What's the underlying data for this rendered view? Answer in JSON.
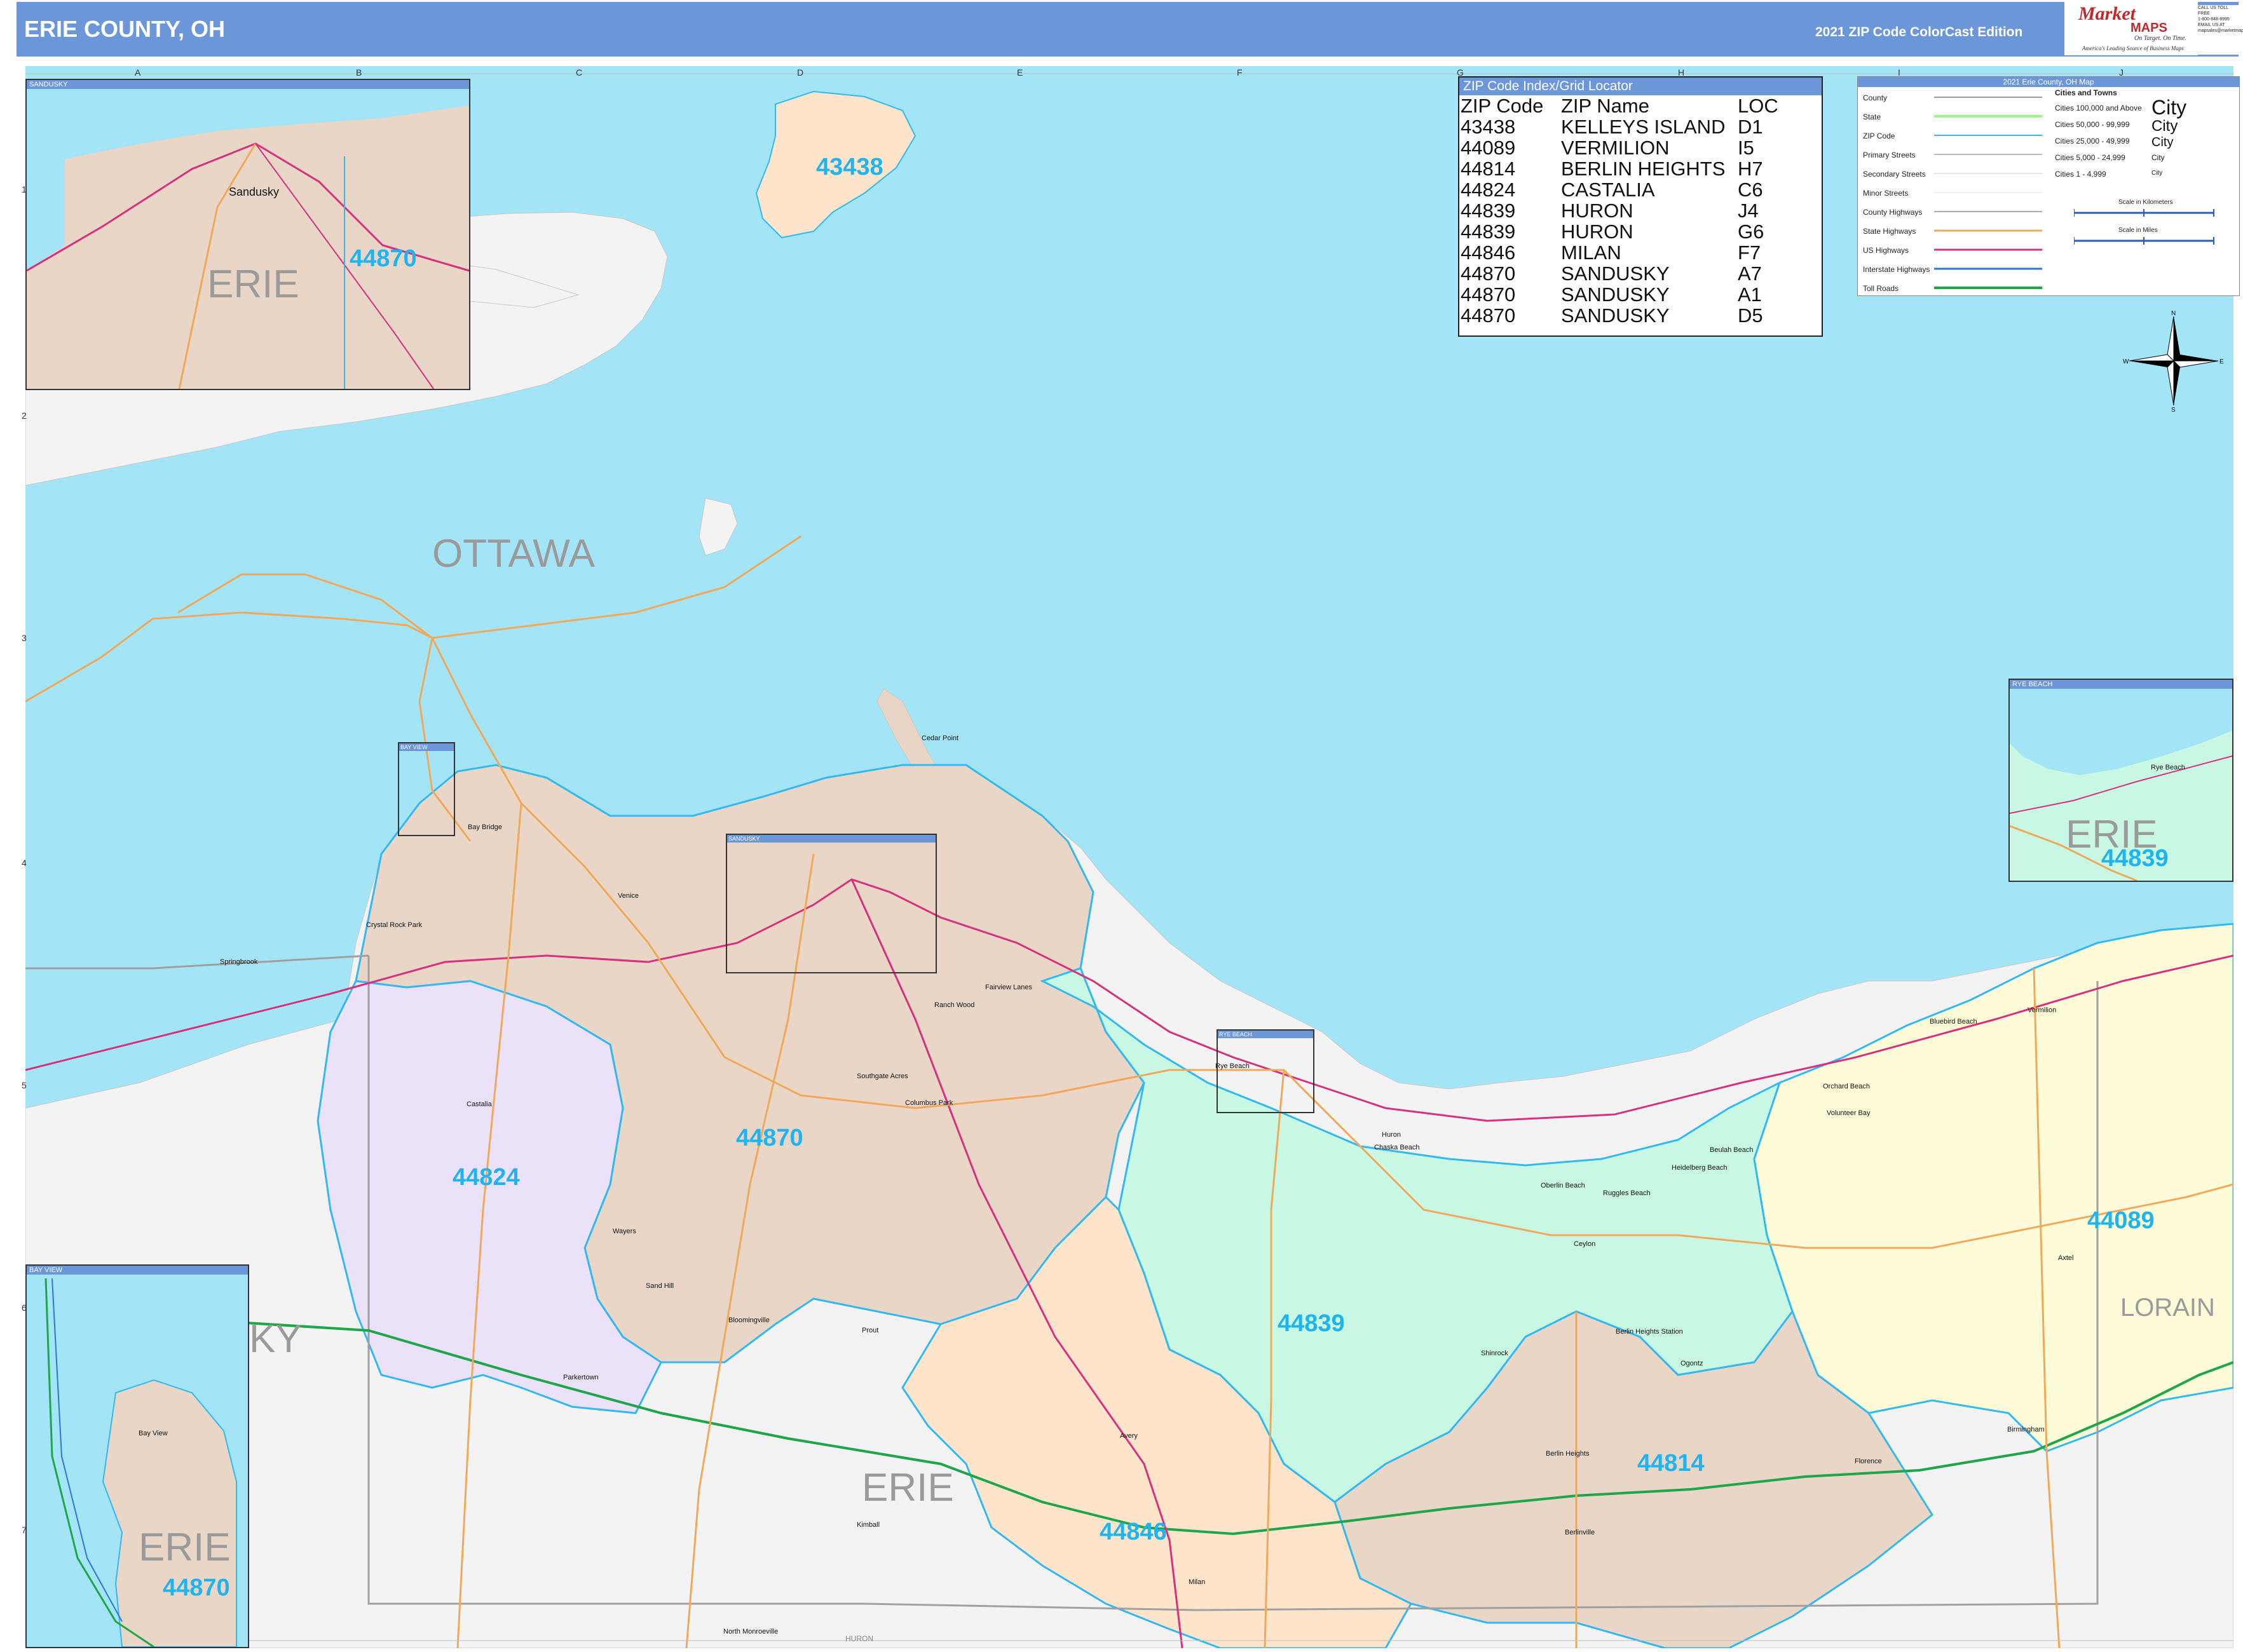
{
  "header": {
    "title": "ERIE COUNTY, OH",
    "edition": "2021 ZIP Code ColorCast Edition",
    "logo_brand": "Market",
    "logo_brand2": "MAPS",
    "logo_tagline": "On Target. On Time.",
    "logo_subtag": "America's Leading Source of Business Maps",
    "contact_lines": [
      "CALL US TOLL FREE",
      "1-800-848-8995",
      "EMAIL US AT",
      "mapsales@marketmaps.com"
    ]
  },
  "grid": {
    "columns": [
      "A",
      "B",
      "C",
      "D",
      "E",
      "F",
      "G",
      "H",
      "I",
      "J"
    ],
    "rows": [
      "1",
      "2",
      "3",
      "4",
      "5",
      "6",
      "7"
    ]
  },
  "zip_index": {
    "heading": "ZIP Code Index/Grid Locator",
    "columns": [
      "ZIP Code",
      "ZIP Name",
      "LOC"
    ],
    "rows": [
      [
        "43438",
        "KELLEYS ISLAND",
        "D1"
      ],
      [
        "44089",
        "VERMILION",
        "I5"
      ],
      [
        "44814",
        "BERLIN HEIGHTS",
        "H7"
      ],
      [
        "44824",
        "CASTALIA",
        "C6"
      ],
      [
        "44839",
        "HURON",
        "J4"
      ],
      [
        "44839",
        "HURON",
        "G6"
      ],
      [
        "44846",
        "MILAN",
        "F7"
      ],
      [
        "44870",
        "SANDUSKY",
        "A7"
      ],
      [
        "44870",
        "SANDUSKY",
        "A1"
      ],
      [
        "44870",
        "SANDUSKY",
        "D5"
      ]
    ]
  },
  "legend": {
    "heading": "2021 Erie County, OH Map",
    "items": [
      "County",
      "State",
      "ZIP Code",
      "Primary Streets",
      "Secondary Streets",
      "Minor Streets",
      "County Highways",
      "State Highways",
      "US Highways",
      "Interstate Highways",
      "Toll Roads"
    ],
    "cities_heading": "Cities and Towns",
    "city_classes": [
      "Cities 100,000 and Above",
      "Cities 50,000 - 99,999",
      "Cities 25,000 - 49,999",
      "Cities 5,000 - 24,999",
      "Cities 1 - 4,999"
    ],
    "city_example": "City",
    "scale_km": "Scale in Kilometers",
    "scale_miles": "Scale in Miles"
  },
  "compass": {
    "n": "N",
    "s": "S",
    "e": "E",
    "w": "W"
  },
  "colors": {
    "water": "#a4e4f7",
    "land_outside": "#f3f3f3",
    "zip_44870": "#e9d6c6",
    "zip_44824": "#ebe1f9",
    "zip_44839": "#c8f7e3",
    "zip_44089": "#fefcd8",
    "zip_44846": "#fde4cb",
    "zip_44814": "#e9d6c6",
    "zip_43438": "#fde4cb",
    "zip_boundary": "#31b9f0",
    "interstate": "#1fa54a",
    "us_highway": "#d6307f",
    "state_highway": "#f0a95b",
    "header": "#6b97d8"
  },
  "zip_labels": [
    {
      "zip": "43438"
    },
    {
      "zip": "44870"
    },
    {
      "zip": "44824"
    },
    {
      "zip": "44839"
    },
    {
      "zip": "44089"
    },
    {
      "zip": "44846"
    },
    {
      "zip": "44814"
    }
  ],
  "county_labels": [
    "OTTAWA",
    "ERIE",
    "LORAIN",
    "KY",
    "HURON"
  ],
  "places": [
    "Bay Bridge",
    "Venice",
    "Crystal Rock Park",
    "Springbrook",
    "Castalia",
    "Ranch Wood",
    "Fairview Lanes",
    "Southgate Acres",
    "Columbus Park",
    "Cedar Point",
    "Rye Beach",
    "Huron",
    "Chaska Beach",
    "Oberlin Beach",
    "Ruggles Beach",
    "Heidelberg Beach",
    "Beulah Beach",
    "Volunteer Bay",
    "Orchard Beach",
    "Bluebird Beach",
    "Vermilion",
    "Ceylon",
    "Axtel",
    "Wayers",
    "Sand Hill",
    "Bloomingville",
    "Prout",
    "Parkertown",
    "Avery",
    "Milan",
    "Kimball",
    "North Monroeville",
    "Shinrock",
    "Berlin Heights Station",
    "Ogontz",
    "Berlin Heights",
    "Berlinville",
    "Florence",
    "Birmingham"
  ],
  "insets": {
    "sandusky": {
      "title": "SANDUSKY",
      "city": "Sandusky",
      "county": "ERIE",
      "zip": "44870"
    },
    "bay_view": {
      "title": "BAY VIEW",
      "city": "Bay View",
      "county": "ERIE",
      "zip": "44870"
    },
    "rye_beach": {
      "title": "RYE BEACH",
      "city": "Rye Beach",
      "county": "ERIE",
      "zip": "44839"
    }
  }
}
